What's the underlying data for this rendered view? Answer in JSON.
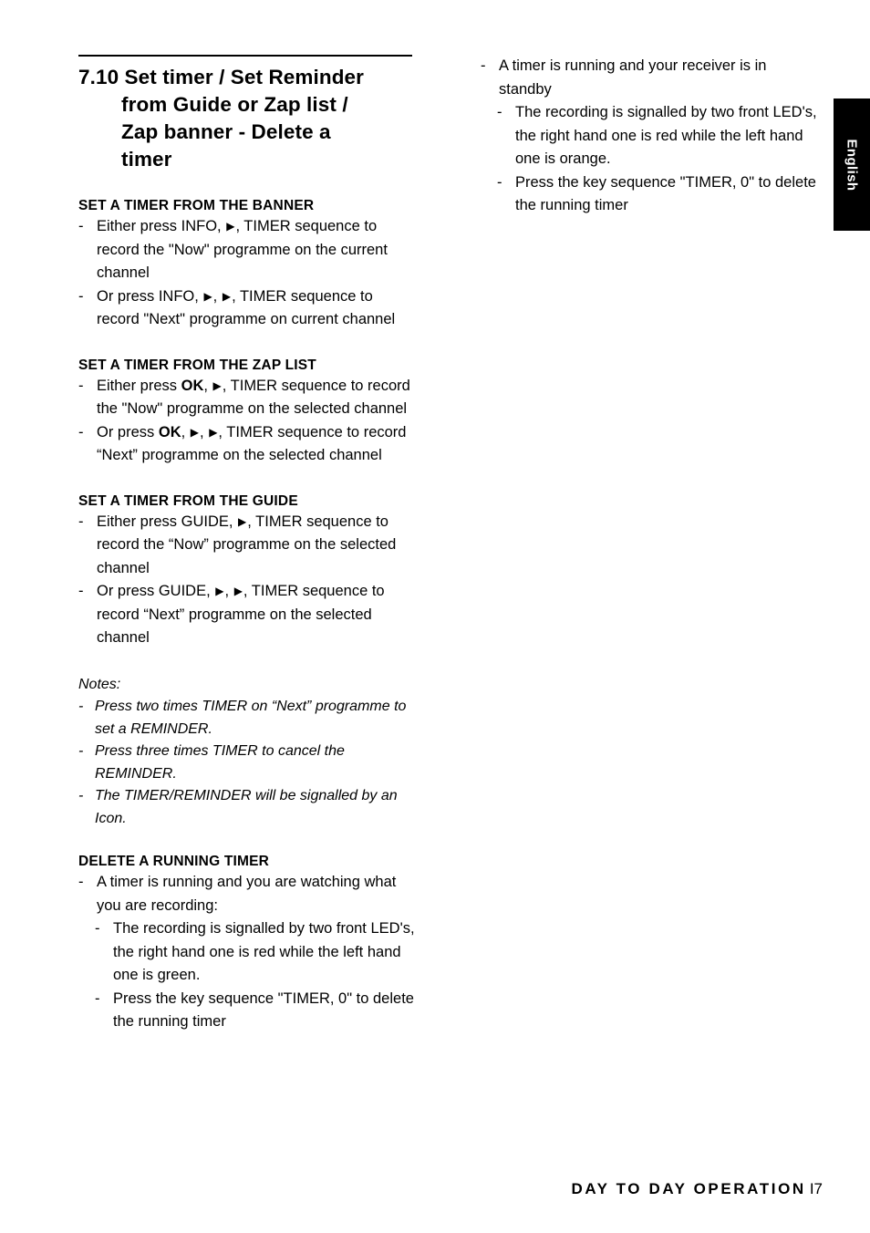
{
  "document": {
    "title_lines": [
      "7.10 Set timer / Set Reminder",
      "from Guide or Zap list /",
      "Zap banner - Delete a",
      "timer"
    ],
    "side_tab_label": "English",
    "footer": {
      "text": "DAY TO DAY OPERATION",
      "page_number": "I7"
    },
    "left_column": {
      "sections": [
        {
          "heading": "SET A TIMER FROM THE BANNER",
          "items": [
            "Either press INFO, ▶ , TIMER sequence to record the \"Now\" programme on the current channel",
            "Or press INFO, ▶ ,  ▶ , TIMER sequence to record \"Next\" programme on current channel"
          ]
        },
        {
          "heading": "SET A TIMER FROM THE ZAP LIST",
          "items": [
            "Either press OK, ▶ , TIMER sequence to record the \"Now\" programme on the selected channel",
            "Or press OK, ▶ ,  ▶ , TIMER sequence to record “Next” programme on the selected channel"
          ]
        },
        {
          "heading": "SET A TIMER FROM THE GUIDE",
          "items": [
            "Either press GUIDE, ▶ , TIMER sequence to record the “Now” programme on the selected channel",
            "Or press GUIDE, ▶ ,  ▶ , TIMER sequence to record “Next” programme on the selected channel"
          ]
        }
      ],
      "notes": {
        "heading": "Notes:",
        "items": [
          "Press two times TIMER on “Next” programme to set a REMINDER.",
          "Press three times TIMER to cancel the REMINDER.",
          "The TIMER/REMINDER will be signalled by an Icon."
        ]
      },
      "delete_section": {
        "heading": "DELETE A RUNNING TIMER",
        "item": "A timer is running and you are watching what you are recording:",
        "subitems": [
          "The recording is signalled by two front LED's, the right  hand one is red while the left hand  one is green.",
          "Press the key sequence \"TIMER, 0\" to delete the running timer"
        ]
      }
    },
    "right_column": {
      "item": "A timer is running and your receiver is in standby",
      "subitems": [
        "The recording is signalled by two front LED's, the right hand  one is red while the left hand one is orange.",
        "Press the key sequence \"TIMER, 0\" to delete the running timer"
      ]
    }
  }
}
